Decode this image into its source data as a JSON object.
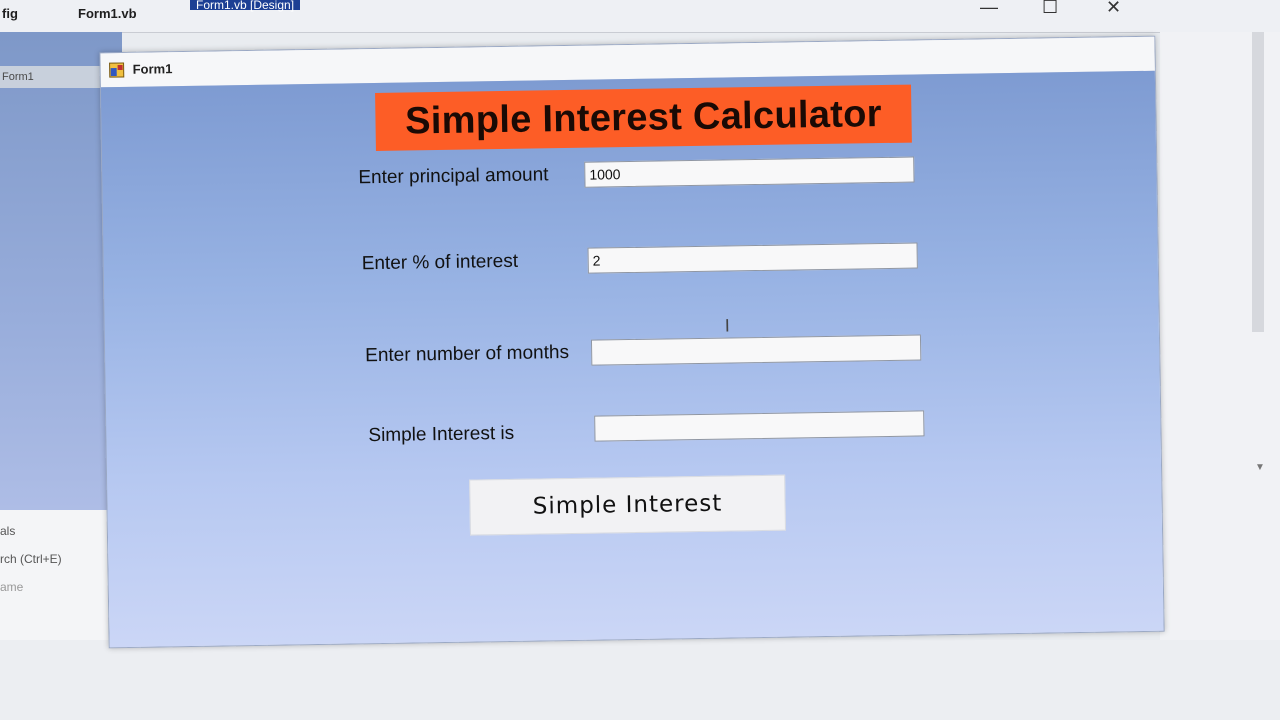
{
  "ide": {
    "tabs": [
      {
        "label": "fig"
      },
      {
        "label": "Form1.vb"
      },
      {
        "label": "Form1.vb [Design]"
      }
    ],
    "left_panel_tab": "Form1",
    "properties_panel": {
      "title_fragment": "als",
      "search_placeholder": "rch (Ctrl+E)",
      "name_fragment": "ame"
    },
    "window_controls": {
      "minimize": "—",
      "maximize": "☐",
      "close": "✕"
    }
  },
  "form": {
    "title": "Form1",
    "heading": "Simple Interest Calculator",
    "fields": [
      {
        "label": "Enter principal amount",
        "value": "1000"
      },
      {
        "label": "Enter % of interest",
        "value": "2"
      },
      {
        "label": "Enter number of months",
        "value": ""
      },
      {
        "label": "Simple Interest is",
        "value": ""
      }
    ],
    "button_label": "Simple Interest"
  },
  "colors": {
    "heading_bg": "#fd5d26",
    "form_bg": "#97b2e3",
    "ide_active_tab": "#1c3f94"
  }
}
